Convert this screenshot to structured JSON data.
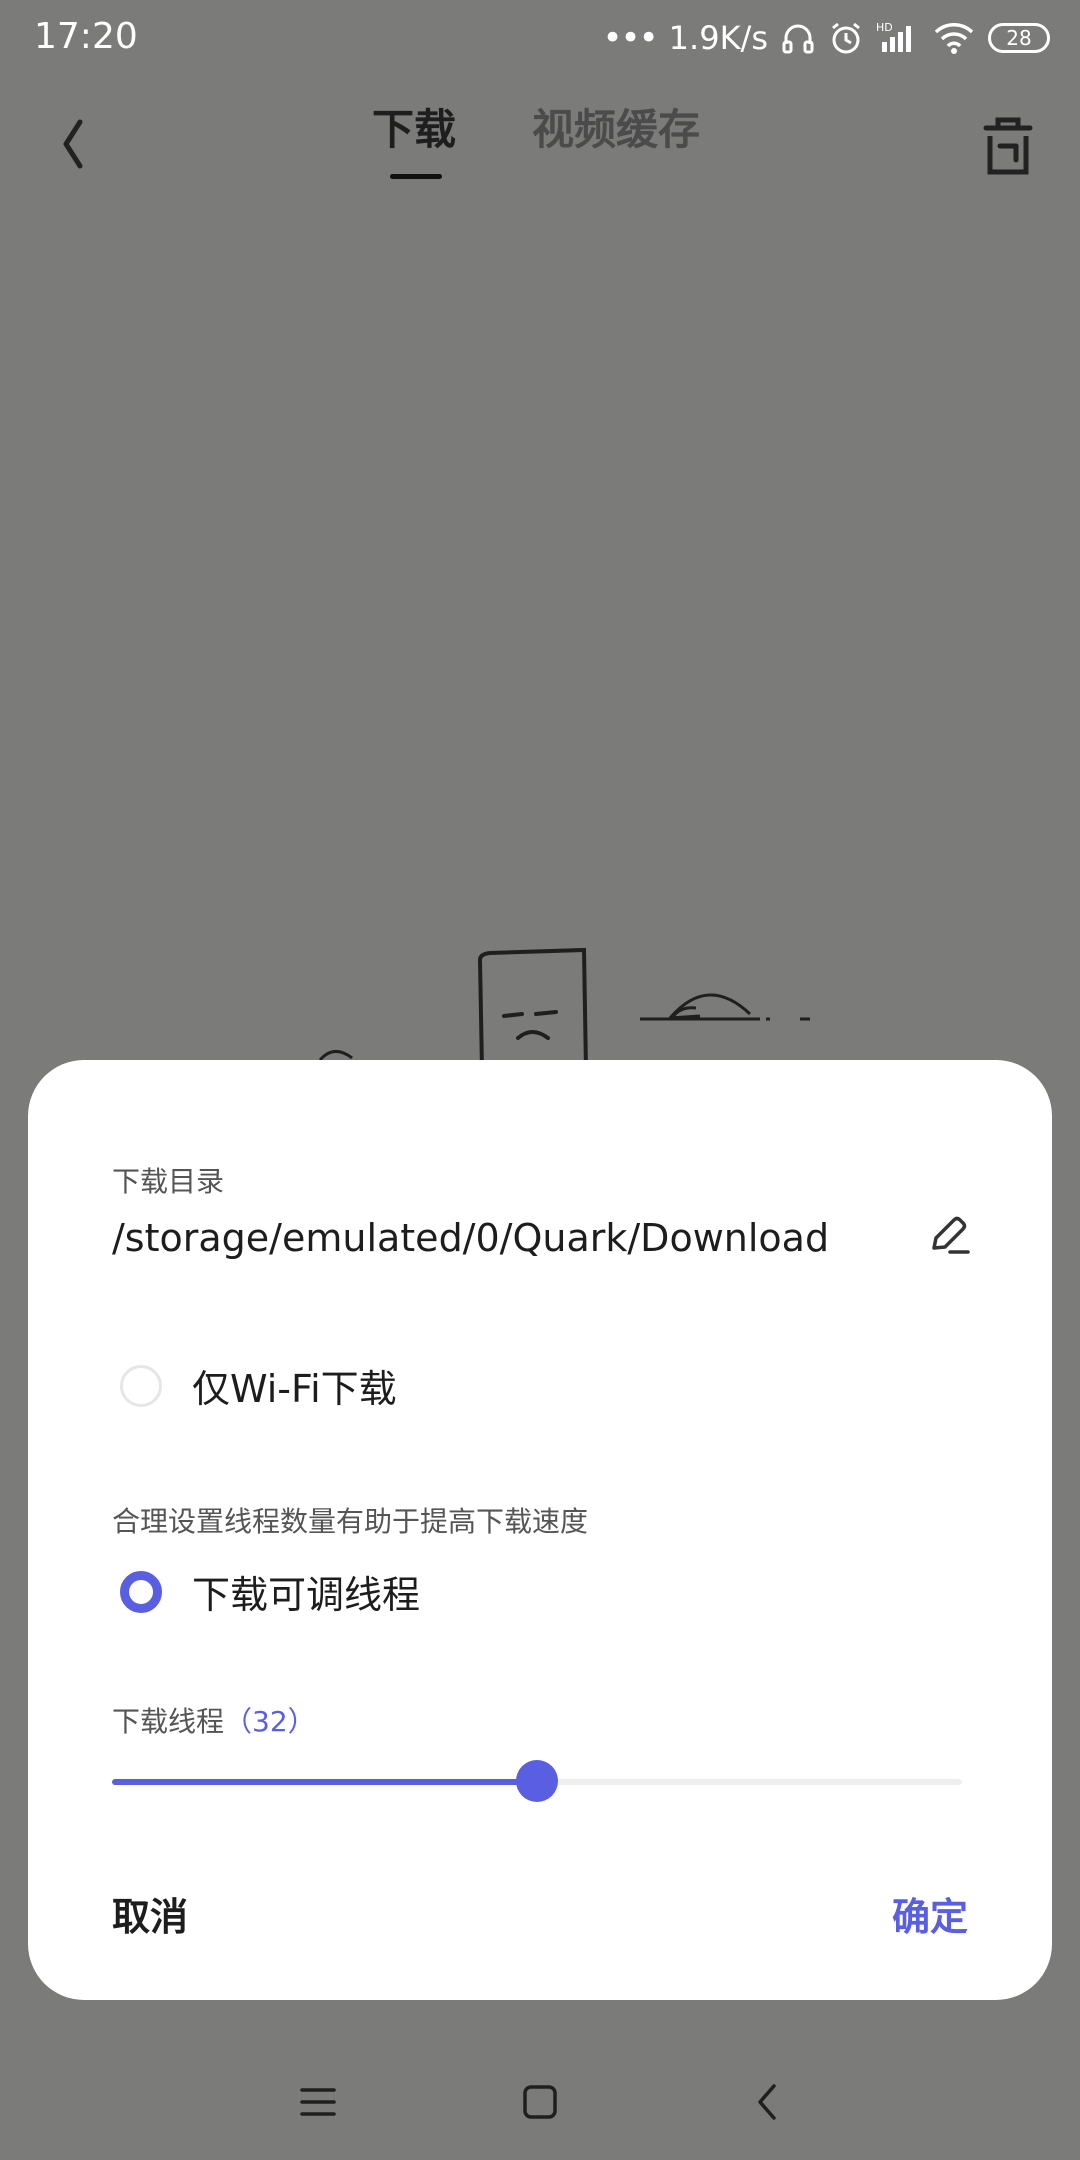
{
  "status_bar": {
    "time": "17:20",
    "network_speed": "1.9K/s",
    "battery_level": "28",
    "icons": [
      "signal-dots-icon",
      "headphones-icon",
      "alarm-icon",
      "hd-signal-icon",
      "wifi-icon",
      "battery-icon"
    ]
  },
  "header": {
    "tabs": [
      {
        "label": "下载",
        "active": true
      },
      {
        "label": "视频缓存",
        "active": false
      }
    ],
    "back_icon": "chevron-left-icon",
    "delete_icon": "trash-icon"
  },
  "dialog": {
    "dir_label": "下载目录",
    "dir_value": "/storage/emulated/0/Quark/Download",
    "edit_icon": "pencil-icon",
    "wifi_only_label": "仅Wi-Fi下载",
    "wifi_only_checked": false,
    "thread_hint": "合理设置线程数量有助于提高下载速度",
    "adjustable_label": "下载可调线程",
    "adjustable_checked": true,
    "thread_label": "下载线程",
    "thread_count": "（32）",
    "slider_value": 0.5,
    "cancel_label": "取消",
    "ok_label": "确定"
  },
  "nav_bar": {
    "icons": [
      "menu-icon",
      "home-icon",
      "back-icon"
    ]
  },
  "colors": {
    "accent": "#5a5ee0",
    "overlay": "#7b7c79",
    "dialog_bg": "#ffffff"
  }
}
